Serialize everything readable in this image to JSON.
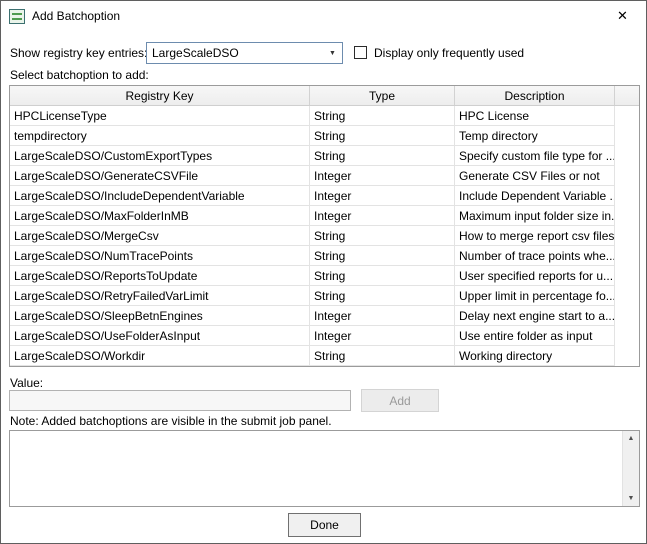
{
  "window": {
    "title": "Add Batchoption"
  },
  "icons": {
    "close": "✕",
    "dropdown": "▼",
    "scroll_up": "▲",
    "scroll_down": "▼",
    "check": "✓"
  },
  "filters": {
    "registry_label": "Show registry key entries:",
    "registry_selected": "LargeScaleDSO",
    "frequent_label": "Display only frequently used",
    "frequent_checked": false
  },
  "table": {
    "select_label": "Select batchoption to add:",
    "headers": [
      "Registry Key",
      "Type",
      "Description"
    ],
    "rows": [
      {
        "key": "HPCLicenseType",
        "type": "String",
        "desc": "HPC License"
      },
      {
        "key": "tempdirectory",
        "type": "String",
        "desc": "Temp directory"
      },
      {
        "key": "LargeScaleDSO/CustomExportTypes",
        "type": "String",
        "desc": "Specify custom file type for ..."
      },
      {
        "key": "LargeScaleDSO/GenerateCSVFile",
        "type": "Integer",
        "desc": "Generate CSV Files or not"
      },
      {
        "key": "LargeScaleDSO/IncludeDependentVariable",
        "type": "Integer",
        "desc": "Include Dependent Variable ..."
      },
      {
        "key": "LargeScaleDSO/MaxFolderInMB",
        "type": "Integer",
        "desc": "Maximum input folder size in..."
      },
      {
        "key": "LargeScaleDSO/MergeCsv",
        "type": "String",
        "desc": "How to merge report csv files"
      },
      {
        "key": "LargeScaleDSO/NumTracePoints",
        "type": "String",
        "desc": "Number of trace points whe..."
      },
      {
        "key": "LargeScaleDSO/ReportsToUpdate",
        "type": "String",
        "desc": "User specified reports for u..."
      },
      {
        "key": "LargeScaleDSO/RetryFailedVarLimit",
        "type": "String",
        "desc": "Upper limit in percentage fo..."
      },
      {
        "key": "LargeScaleDSO/SleepBetnEngines",
        "type": "Integer",
        "desc": "Delay next engine start to a..."
      },
      {
        "key": "LargeScaleDSO/UseFolderAsInput",
        "type": "Integer",
        "desc": "Use entire folder as input"
      },
      {
        "key": "LargeScaleDSO/Workdir",
        "type": "String",
        "desc": "Working directory"
      }
    ]
  },
  "value_section": {
    "label": "Value:",
    "input_value": "",
    "add_label": "Add"
  },
  "note": {
    "text": "Note: Added batchoptions are visible in the submit job panel.",
    "content": ""
  },
  "footer": {
    "done_label": "Done"
  }
}
